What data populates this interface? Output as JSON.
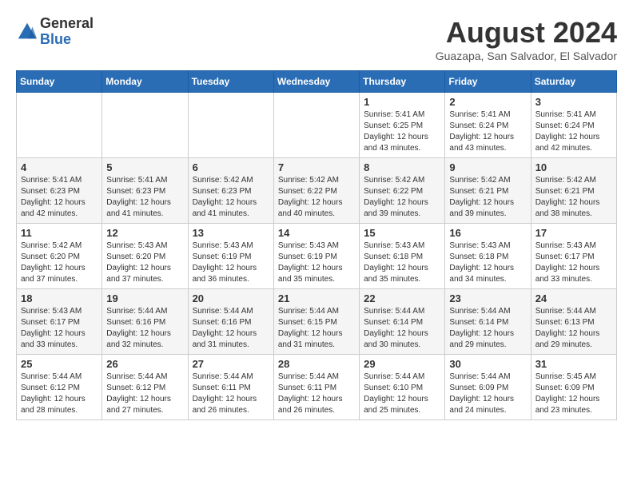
{
  "header": {
    "logo_line1": "General",
    "logo_line2": "Blue",
    "month_title": "August 2024",
    "subtitle": "Guazapa, San Salvador, El Salvador"
  },
  "days_of_week": [
    "Sunday",
    "Monday",
    "Tuesday",
    "Wednesday",
    "Thursday",
    "Friday",
    "Saturday"
  ],
  "weeks": [
    [
      {
        "day": "",
        "info": ""
      },
      {
        "day": "",
        "info": ""
      },
      {
        "day": "",
        "info": ""
      },
      {
        "day": "",
        "info": ""
      },
      {
        "day": "1",
        "info": "Sunrise: 5:41 AM\nSunset: 6:25 PM\nDaylight: 12 hours\nand 43 minutes."
      },
      {
        "day": "2",
        "info": "Sunrise: 5:41 AM\nSunset: 6:24 PM\nDaylight: 12 hours\nand 43 minutes."
      },
      {
        "day": "3",
        "info": "Sunrise: 5:41 AM\nSunset: 6:24 PM\nDaylight: 12 hours\nand 42 minutes."
      }
    ],
    [
      {
        "day": "4",
        "info": "Sunrise: 5:41 AM\nSunset: 6:23 PM\nDaylight: 12 hours\nand 42 minutes."
      },
      {
        "day": "5",
        "info": "Sunrise: 5:41 AM\nSunset: 6:23 PM\nDaylight: 12 hours\nand 41 minutes."
      },
      {
        "day": "6",
        "info": "Sunrise: 5:42 AM\nSunset: 6:23 PM\nDaylight: 12 hours\nand 41 minutes."
      },
      {
        "day": "7",
        "info": "Sunrise: 5:42 AM\nSunset: 6:22 PM\nDaylight: 12 hours\nand 40 minutes."
      },
      {
        "day": "8",
        "info": "Sunrise: 5:42 AM\nSunset: 6:22 PM\nDaylight: 12 hours\nand 39 minutes."
      },
      {
        "day": "9",
        "info": "Sunrise: 5:42 AM\nSunset: 6:21 PM\nDaylight: 12 hours\nand 39 minutes."
      },
      {
        "day": "10",
        "info": "Sunrise: 5:42 AM\nSunset: 6:21 PM\nDaylight: 12 hours\nand 38 minutes."
      }
    ],
    [
      {
        "day": "11",
        "info": "Sunrise: 5:42 AM\nSunset: 6:20 PM\nDaylight: 12 hours\nand 37 minutes."
      },
      {
        "day": "12",
        "info": "Sunrise: 5:43 AM\nSunset: 6:20 PM\nDaylight: 12 hours\nand 37 minutes."
      },
      {
        "day": "13",
        "info": "Sunrise: 5:43 AM\nSunset: 6:19 PM\nDaylight: 12 hours\nand 36 minutes."
      },
      {
        "day": "14",
        "info": "Sunrise: 5:43 AM\nSunset: 6:19 PM\nDaylight: 12 hours\nand 35 minutes."
      },
      {
        "day": "15",
        "info": "Sunrise: 5:43 AM\nSunset: 6:18 PM\nDaylight: 12 hours\nand 35 minutes."
      },
      {
        "day": "16",
        "info": "Sunrise: 5:43 AM\nSunset: 6:18 PM\nDaylight: 12 hours\nand 34 minutes."
      },
      {
        "day": "17",
        "info": "Sunrise: 5:43 AM\nSunset: 6:17 PM\nDaylight: 12 hours\nand 33 minutes."
      }
    ],
    [
      {
        "day": "18",
        "info": "Sunrise: 5:43 AM\nSunset: 6:17 PM\nDaylight: 12 hours\nand 33 minutes."
      },
      {
        "day": "19",
        "info": "Sunrise: 5:44 AM\nSunset: 6:16 PM\nDaylight: 12 hours\nand 32 minutes."
      },
      {
        "day": "20",
        "info": "Sunrise: 5:44 AM\nSunset: 6:16 PM\nDaylight: 12 hours\nand 31 minutes."
      },
      {
        "day": "21",
        "info": "Sunrise: 5:44 AM\nSunset: 6:15 PM\nDaylight: 12 hours\nand 31 minutes."
      },
      {
        "day": "22",
        "info": "Sunrise: 5:44 AM\nSunset: 6:14 PM\nDaylight: 12 hours\nand 30 minutes."
      },
      {
        "day": "23",
        "info": "Sunrise: 5:44 AM\nSunset: 6:14 PM\nDaylight: 12 hours\nand 29 minutes."
      },
      {
        "day": "24",
        "info": "Sunrise: 5:44 AM\nSunset: 6:13 PM\nDaylight: 12 hours\nand 29 minutes."
      }
    ],
    [
      {
        "day": "25",
        "info": "Sunrise: 5:44 AM\nSunset: 6:12 PM\nDaylight: 12 hours\nand 28 minutes."
      },
      {
        "day": "26",
        "info": "Sunrise: 5:44 AM\nSunset: 6:12 PM\nDaylight: 12 hours\nand 27 minutes."
      },
      {
        "day": "27",
        "info": "Sunrise: 5:44 AM\nSunset: 6:11 PM\nDaylight: 12 hours\nand 26 minutes."
      },
      {
        "day": "28",
        "info": "Sunrise: 5:44 AM\nSunset: 6:11 PM\nDaylight: 12 hours\nand 26 minutes."
      },
      {
        "day": "29",
        "info": "Sunrise: 5:44 AM\nSunset: 6:10 PM\nDaylight: 12 hours\nand 25 minutes."
      },
      {
        "day": "30",
        "info": "Sunrise: 5:44 AM\nSunset: 6:09 PM\nDaylight: 12 hours\nand 24 minutes."
      },
      {
        "day": "31",
        "info": "Sunrise: 5:45 AM\nSunset: 6:09 PM\nDaylight: 12 hours\nand 23 minutes."
      }
    ]
  ]
}
